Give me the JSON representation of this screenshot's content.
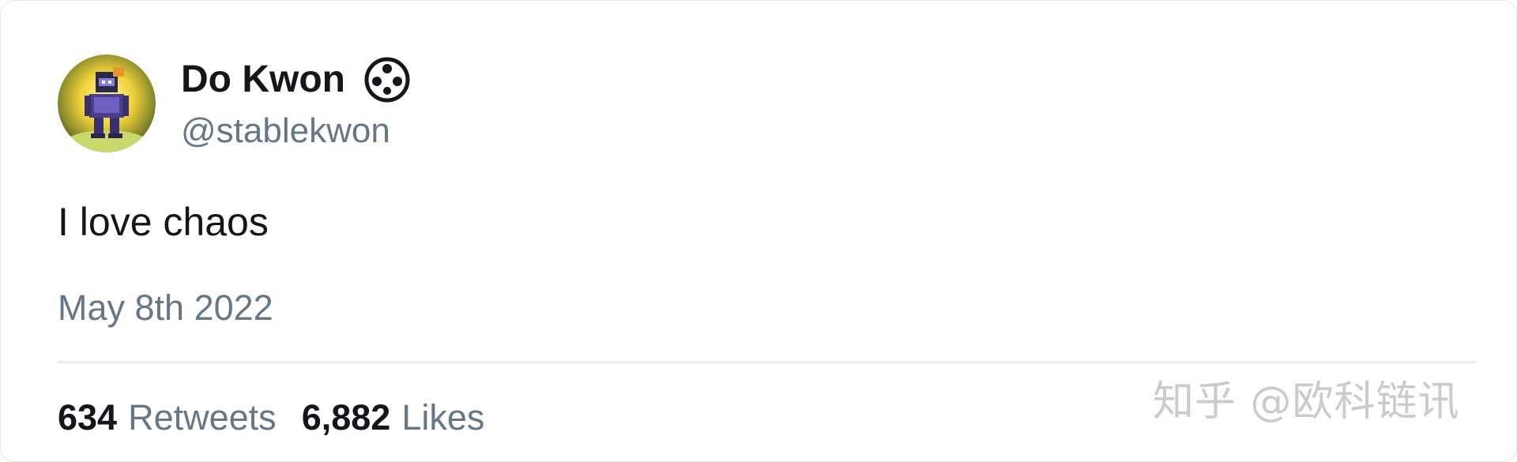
{
  "tweet": {
    "author": {
      "display_name": "Do Kwon",
      "handle": "@stablekwon",
      "badge_icon": "circle-dots-icon",
      "avatar": "pixel-art-avatar"
    },
    "text": "I love chaos",
    "date": "May 8th 2022",
    "stats": {
      "retweets_count": "634",
      "retweets_label": "Retweets",
      "likes_count": "6,882",
      "likes_label": "Likes"
    }
  },
  "watermark": {
    "text": "知乎 @欧科链讯"
  },
  "colors": {
    "text_primary": "#14171a",
    "text_secondary": "#657786",
    "divider": "#e6ecf0",
    "card_border": "#e1e8ed"
  }
}
